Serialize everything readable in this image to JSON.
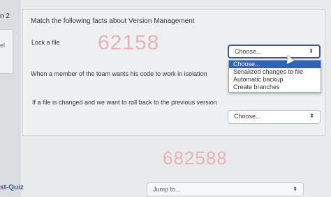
{
  "left": {
    "question_number_partial": "n 2",
    "flag_partial": "el",
    "post_quiz_partial": "st-Quiz"
  },
  "question": {
    "title": "Match the following facts about Version Management",
    "rows": [
      {
        "label": "Lock  a file",
        "selected": "Choose..."
      },
      {
        "label": "When a member of the team wants his code to work in isolation",
        "selected": ""
      },
      {
        "label": "If a file is changed and we want to roll back to the previous version",
        "selected": "Choose..."
      }
    ]
  },
  "dropdown": {
    "options": [
      "Choose...",
      "Serialized changes to file",
      "Automatic backup",
      "Create branches"
    ],
    "active_index": 0
  },
  "watermarks": {
    "top": "62158",
    "bottom": "682588"
  },
  "footer": {
    "jump_placeholder": "Jump to..."
  },
  "colors": {
    "accent": "#2d63b8",
    "watermark": "#e6b4b7"
  }
}
